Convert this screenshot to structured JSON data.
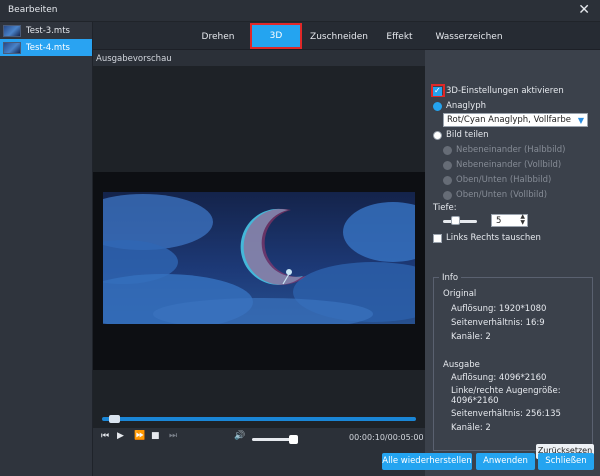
{
  "window": {
    "title": "Bearbeiten",
    "close": "✕"
  },
  "files": [
    {
      "name": "Test-3.mts"
    },
    {
      "name": "Test-4.mts"
    }
  ],
  "tabs": [
    {
      "label": "Drehen"
    },
    {
      "label": "3D"
    },
    {
      "label": "Zuschneiden"
    },
    {
      "label": "Effekt"
    },
    {
      "label": "Wasserzeichen"
    }
  ],
  "preview": {
    "label": "Ausgabevorschau",
    "timecode": "00:00:10/00:05:00",
    "progress_fraction": 0.02,
    "volume_fraction": 0.85
  },
  "settings": {
    "enable_3d": "3D-Einstellungen aktivieren",
    "anaglyph": "Anaglyph",
    "anaglyph_select": "Rot/Cyan Anaglyph, Vollfarbe",
    "split": "Bild teilen",
    "split_options": [
      "Nebeneinander (Halbbild)",
      "Nebeneinander (Vollbild)",
      "Oben/Unten (Halbbild)",
      "Oben/Unten (Vollbild)"
    ],
    "depth_label": "Tiefe:",
    "depth_value": "5",
    "swap": "Links Rechts tauschen"
  },
  "info": {
    "title": "Info",
    "original_title": "Original",
    "original": [
      "Auflösung: 1920*1080",
      "Seitenverhältnis: 16:9",
      "Kanäle: 2"
    ],
    "output_title": "Ausgabe",
    "output": [
      "Auflösung: 4096*2160",
      "Linke/rechte Augengröße:",
      "4096*2160",
      "Seitenverhältnis: 256:135",
      "Kanäle: 2"
    ]
  },
  "buttons": {
    "reset": "Zurücksetzen",
    "reset_all": "Alle wiederherstellen",
    "apply": "Anwenden",
    "close": "Schließen"
  },
  "colors": {
    "accent": "#24a4f0",
    "highlight": "#e02828"
  }
}
